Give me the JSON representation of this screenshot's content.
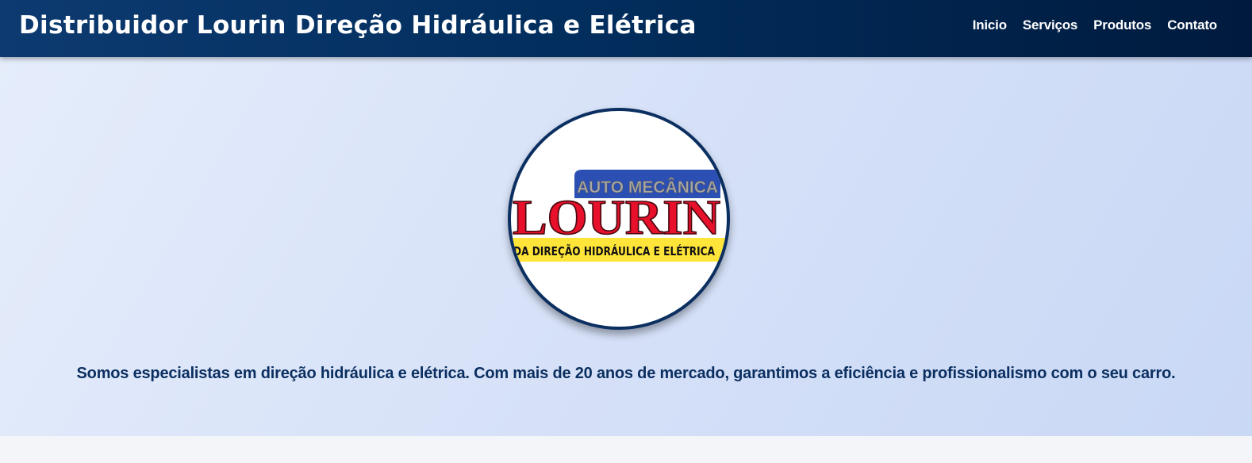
{
  "header": {
    "title": "Distribuidor Lourin Direção Hidráulica e Elétrica",
    "nav": [
      {
        "label": "Inicio"
      },
      {
        "label": "Serviços"
      },
      {
        "label": "Produtos"
      },
      {
        "label": "Contato"
      }
    ]
  },
  "hero": {
    "logo": {
      "top_text": "AUTO MECÂNICA",
      "brand": "LOURIN",
      "bottom_text": "DA DIREÇÃO HIDRÁULICA E ELÉTRICA"
    },
    "tagline": "Somos especialistas em direção hidráulica e elétrica. Com mais de 20 anos de mercado, garantimos a eficiência e profissionalismo com o seu carro."
  },
  "colors": {
    "header_bg": "#022e5e",
    "accent_navy": "#0b2f60",
    "logo_red": "#e8102a",
    "logo_yellow": "#ffe43a",
    "logo_blue": "#2c4fb4"
  }
}
